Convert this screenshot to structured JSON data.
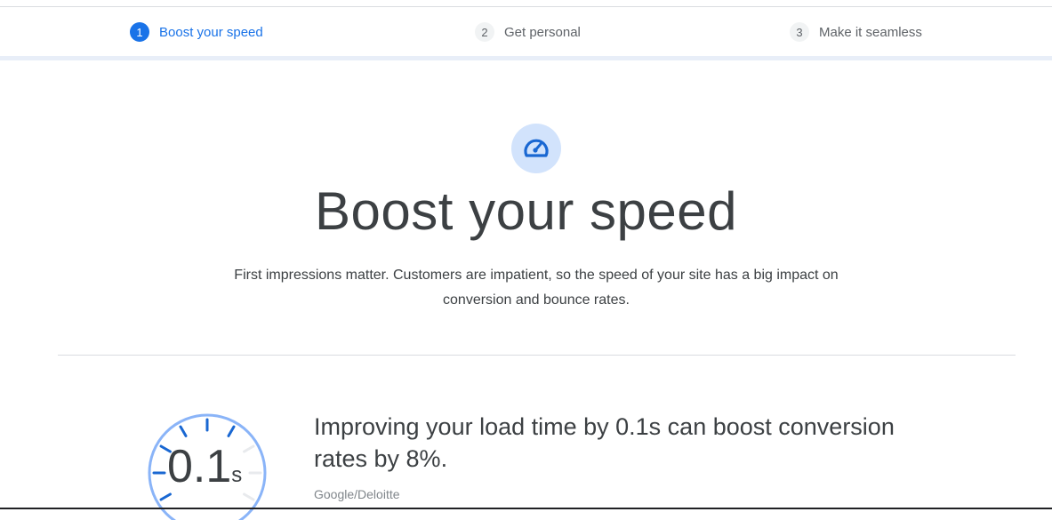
{
  "stepper": {
    "steps": [
      {
        "number": "1",
        "label": "Boost your speed",
        "active": true
      },
      {
        "number": "2",
        "label": "Get personal",
        "active": false
      },
      {
        "number": "3",
        "label": "Make it seamless",
        "active": false
      }
    ]
  },
  "hero": {
    "icon": "speedometer-icon",
    "title": "Boost your speed",
    "description": "First impressions matter. Customers are impatient, so the speed of your site has a big impact on conversion and bounce rates."
  },
  "stat": {
    "gauge_value": "0.1",
    "gauge_unit": "s",
    "text": "Improving your load time by 0.1s can boost conversion rates by 8%.",
    "source": "Google/Deloitte"
  },
  "colors": {
    "accent": "#1a73e8",
    "icon_bg": "#d2e3fc",
    "gauge_ring": "#8ab4f8",
    "gauge_tick_dark": "#1967d2",
    "gauge_tick_light": "#e8eaed"
  }
}
